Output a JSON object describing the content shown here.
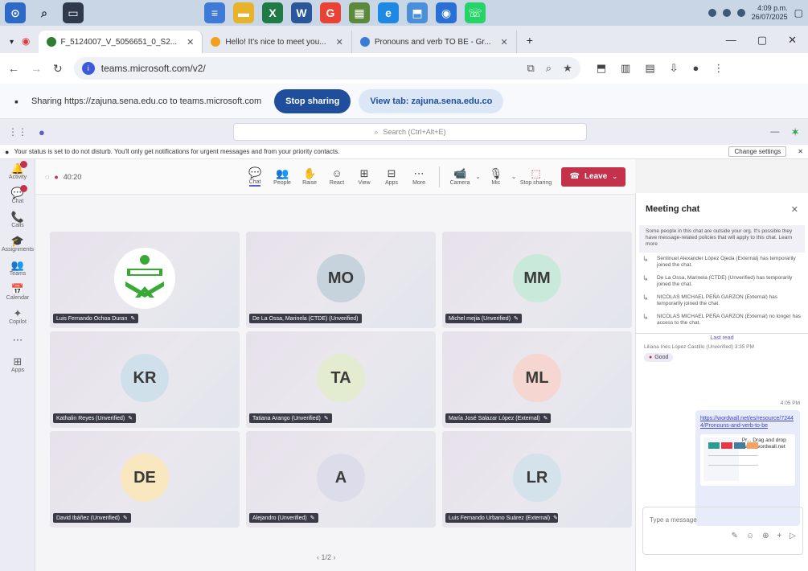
{
  "taskbar": {
    "clock_time": "4:09 p.m.",
    "clock_date": "26/07/2025"
  },
  "browser": {
    "tabs": [
      {
        "label": "F_5124007_V_5056651_0_S2..."
      },
      {
        "label": "Hello! It's nice to meet you..."
      },
      {
        "label": "Pronouns and verb TO BE - Gr..."
      }
    ],
    "url": "teams.microsoft.com/v2/"
  },
  "share_banner": {
    "text": "Sharing https://zajuna.sena.edu.co to teams.microsoft.com",
    "stop_label": "Stop sharing",
    "view_label": "View tab: zajuna.sena.edu.co"
  },
  "teams": {
    "search_placeholder": "Search (Ctrl+Alt+E)",
    "status_notice": "Your status is set to do not disturb. You'll only get notifications for urgent messages and from your priority contacts.",
    "change_settings": "Change settings"
  },
  "rail": {
    "items": [
      {
        "label": "Activity",
        "glyph": "🔔"
      },
      {
        "label": "Chat",
        "glyph": "💬"
      },
      {
        "label": "Calls",
        "glyph": "📞"
      },
      {
        "label": "Assignments",
        "glyph": "🎓"
      },
      {
        "label": "Teams",
        "glyph": "👥"
      },
      {
        "label": "Calendar",
        "glyph": "📅"
      },
      {
        "label": "Copilot",
        "glyph": "✦"
      },
      {
        "label": "",
        "glyph": "⋯"
      },
      {
        "label": "Apps",
        "glyph": "⊞"
      }
    ]
  },
  "meeting": {
    "timer": "40:20",
    "controls": [
      {
        "label": "Chat",
        "glyph": "💬"
      },
      {
        "label": "People",
        "glyph": "👥"
      },
      {
        "label": "Raise",
        "glyph": "✋"
      },
      {
        "label": "React",
        "glyph": "☺"
      },
      {
        "label": "View",
        "glyph": "⊞"
      },
      {
        "label": "Apps",
        "glyph": "⊟"
      },
      {
        "label": "More",
        "glyph": "⋯"
      }
    ],
    "av_controls": [
      {
        "label": "Camera",
        "glyph": "📹"
      },
      {
        "label": "Mic",
        "glyph": "🎙"
      },
      {
        "label": "Stop sharing",
        "glyph": "⬚"
      }
    ],
    "leave_label": "Leave",
    "pager": "1/2",
    "participants": [
      {
        "initials": "",
        "name": "Luis Fernando Ochoa Duran",
        "avatar_bg": "#ffffff",
        "logo": true
      },
      {
        "initials": "MO",
        "name": "De La Ossa, Marinela (CTDE) (Unverified)",
        "avatar_bg": "#c7d3dc"
      },
      {
        "initials": "MM",
        "name": "Michel mejia (Unverified)",
        "avatar_bg": "#c9eadb"
      },
      {
        "initials": "KR",
        "name": "Kathalin Reyes (Unverified)",
        "avatar_bg": "#cfe0ea"
      },
      {
        "initials": "TA",
        "name": "Tatiana Arango (Unverified)",
        "avatar_bg": "#e3ebd0"
      },
      {
        "initials": "ML",
        "name": "María José Salazar López (External)",
        "avatar_bg": "#f5d6d0"
      },
      {
        "initials": "DE",
        "name": "David Ibáñez (Unverified)",
        "avatar_bg": "#f8e7bf"
      },
      {
        "initials": "A",
        "name": "Alejandro (Unverified)",
        "avatar_bg": "#dcdcea"
      },
      {
        "initials": "LR",
        "name": "Luis Fernando Urbano Suárez (External)",
        "avatar_bg": "#d4e2ec"
      }
    ]
  },
  "chat": {
    "title": "Meeting chat",
    "note": "Some people in this chat are outside your org. It's possible they have message-related policies that will apply to this chat. Learn more",
    "system_messages": [
      {
        "glyph": "↳",
        "text": "Sentinuel Alexander López Ojeda (External) has temporarily joined the chat."
      },
      {
        "glyph": "↳",
        "text": "De La Ossa, Marinela (CTDE) (Unverified) has temporarily joined the chat."
      },
      {
        "glyph": "↳",
        "text": "NICOLAS MICHAEL PEÑA GARZON (External) has temporarily joined the chat."
      },
      {
        "glyph": "↳",
        "text": "NICOLAS MICHAEL PEÑA GARZON (External) no longer has access to the chat."
      }
    ],
    "last_read": "Last read",
    "reply_meta": "Liliana Inés López Castillo (Unverified)  3:35 PM",
    "reaction_label": "Good",
    "out_time": "4:05 PM",
    "out_link": "https://wordwall.net/es/resource/72444/Pronouns-and-verb-to-be",
    "preview_text": "Pr... Drag and drop eac... wordwall.net",
    "compose_placeholder": "Type a message"
  }
}
